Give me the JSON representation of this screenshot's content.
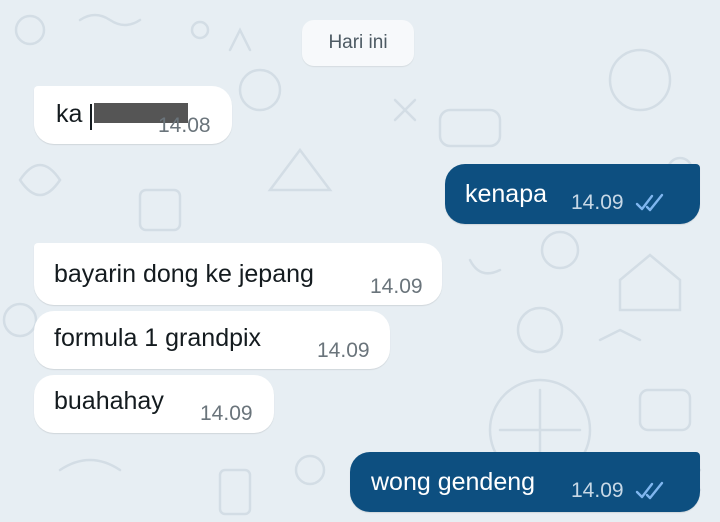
{
  "date_separator": "Hari ini",
  "messages": [
    {
      "direction": "incoming",
      "text": "ka",
      "time": "14.08",
      "redacted": true
    },
    {
      "direction": "outgoing",
      "text": "kenapa",
      "time": "14.09",
      "status": "read-double-check-icon"
    },
    {
      "direction": "incoming",
      "text": "bayarin dong ke jepang",
      "time": "14.09"
    },
    {
      "direction": "incoming",
      "text": "formula 1 grandpix",
      "time": "14.09"
    },
    {
      "direction": "incoming",
      "text": "buahahay",
      "time": "14.09"
    },
    {
      "direction": "outgoing",
      "text": "wong gendeng",
      "time": "14.09",
      "status": "read-double-check-icon"
    }
  ],
  "colors": {
    "background": "#e7eef3",
    "incoming_bubble": "#ffffff",
    "outgoing_bubble": "#0d4f80",
    "read_ticks": "#7fb6ef"
  }
}
